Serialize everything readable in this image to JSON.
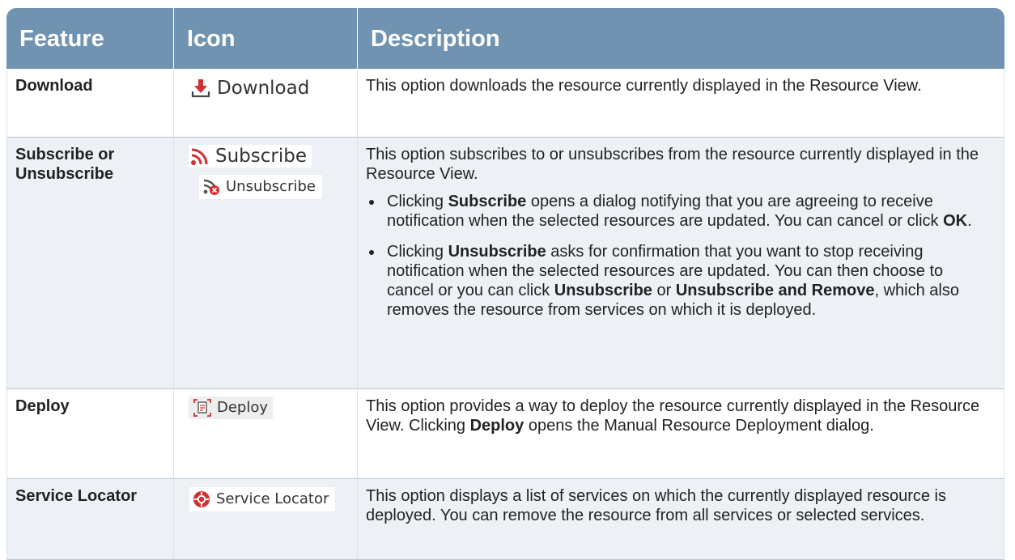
{
  "headers": {
    "feature": "Feature",
    "icon": "Icon",
    "description": "Description"
  },
  "rows": [
    {
      "feature": "Download",
      "icon_label": "Download",
      "icon_name": "download-icon",
      "description": "This option downloads the resource currently displayed in the Resource View."
    },
    {
      "feature": "Subscribe or Unsubscribe",
      "icon_label": "Subscribe",
      "icon_name": "rss-subscribe-icon",
      "icon_label_2": "Unsubscribe",
      "icon_name_2": "rss-unsubscribe-icon",
      "description": "This option subscribes to or unsubscribes from the resource currently displayed in the Resource View.",
      "bullets": [
        {
          "p1": "Clicking ",
          "b1": "Subscribe",
          "p2": " opens a dialog notifying that you are agreeing to receive notification when the selected resources are updated. You can cancel or click ",
          "b2": "OK",
          "p3": "."
        },
        {
          "p1": "Clicking ",
          "b1": "Unsubscribe",
          "p2": " asks for confirmation that you want to stop receiving notification when the selected resources are updated. You can then choose to cancel or you can click ",
          "b2": "Unsubscribe",
          "p3": " or ",
          "b3": "Unsubscribe and Remove",
          "p4": ", which also removes the resource from services on which it is deployed."
        }
      ]
    },
    {
      "feature": "Deploy",
      "icon_label": "Deploy",
      "icon_name": "deploy-icon",
      "description_p1": "This option provides a way to deploy the resource currently displayed in the Resource View. Clicking ",
      "description_b1": "Deploy",
      "description_p2": " opens the Manual Resource Deployment dialog."
    },
    {
      "feature": "Service Locator",
      "icon_label": "Service Locator",
      "icon_name": "service-locator-icon",
      "description": "This option displays a list of services on which the currently displayed resource is deployed. You can remove the resource from all services or selected services."
    }
  ],
  "colors": {
    "header_bg": "#6f93b0",
    "row_alt_bg": "#edf1f5",
    "icon_red": "#d32f2f"
  }
}
